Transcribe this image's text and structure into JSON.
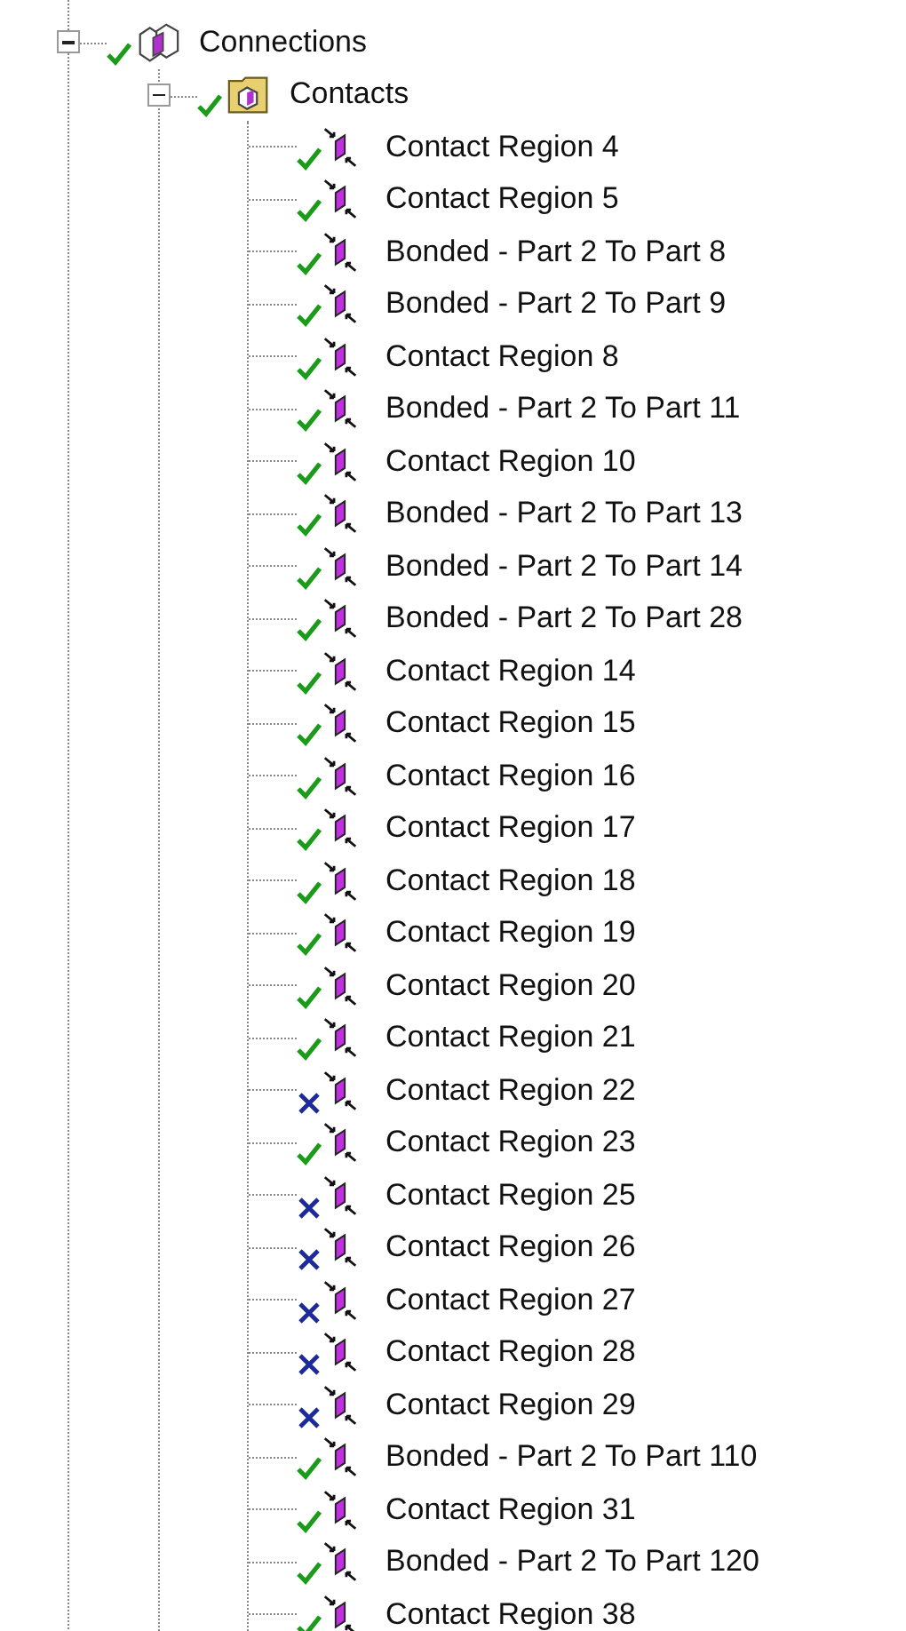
{
  "tree": {
    "label": "Connections",
    "ok": true,
    "expanded": true,
    "kind": "connections",
    "children": [
      {
        "label": "Contacts",
        "ok": true,
        "expanded": true,
        "kind": "folder",
        "children": [
          {
            "label": "Contact Region 4",
            "ok": true,
            "kind": "contact"
          },
          {
            "label": "Contact Region 5",
            "ok": true,
            "kind": "contact"
          },
          {
            "label": "Bonded - Part 2 To Part 8",
            "ok": true,
            "kind": "contact"
          },
          {
            "label": "Bonded - Part 2 To Part 9",
            "ok": true,
            "kind": "contact"
          },
          {
            "label": "Contact Region 8",
            "ok": true,
            "kind": "contact"
          },
          {
            "label": "Bonded - Part 2 To Part 11",
            "ok": true,
            "kind": "contact"
          },
          {
            "label": "Contact Region 10",
            "ok": true,
            "kind": "contact"
          },
          {
            "label": "Bonded - Part 2 To Part 13",
            "ok": true,
            "kind": "contact"
          },
          {
            "label": "Bonded - Part 2 To Part 14",
            "ok": true,
            "kind": "contact"
          },
          {
            "label": "Bonded - Part 2 To Part 28",
            "ok": true,
            "kind": "contact"
          },
          {
            "label": "Contact Region 14",
            "ok": true,
            "kind": "contact"
          },
          {
            "label": "Contact Region 15",
            "ok": true,
            "kind": "contact"
          },
          {
            "label": "Contact Region 16",
            "ok": true,
            "kind": "contact"
          },
          {
            "label": "Contact Region 17",
            "ok": true,
            "kind": "contact"
          },
          {
            "label": "Contact Region 18",
            "ok": true,
            "kind": "contact"
          },
          {
            "label": "Contact Region 19",
            "ok": true,
            "kind": "contact"
          },
          {
            "label": "Contact Region 20",
            "ok": true,
            "kind": "contact"
          },
          {
            "label": "Contact Region 21",
            "ok": true,
            "kind": "contact"
          },
          {
            "label": "Contact Region 22",
            "ok": false,
            "kind": "contact"
          },
          {
            "label": "Contact Region 23",
            "ok": true,
            "kind": "contact"
          },
          {
            "label": "Contact Region 25",
            "ok": false,
            "kind": "contact"
          },
          {
            "label": "Contact Region 26",
            "ok": false,
            "kind": "contact"
          },
          {
            "label": "Contact Region 27",
            "ok": false,
            "kind": "contact"
          },
          {
            "label": "Contact Region 28",
            "ok": false,
            "kind": "contact"
          },
          {
            "label": "Contact Region 29",
            "ok": false,
            "kind": "contact"
          },
          {
            "label": "Bonded - Part 2 To Part 110",
            "ok": true,
            "kind": "contact"
          },
          {
            "label": "Contact Region 31",
            "ok": true,
            "kind": "contact"
          },
          {
            "label": "Bonded - Part 2 To Part 120",
            "ok": true,
            "kind": "contact"
          },
          {
            "label": "Contact Region 38",
            "ok": true,
            "kind": "contact"
          }
        ]
      }
    ]
  }
}
